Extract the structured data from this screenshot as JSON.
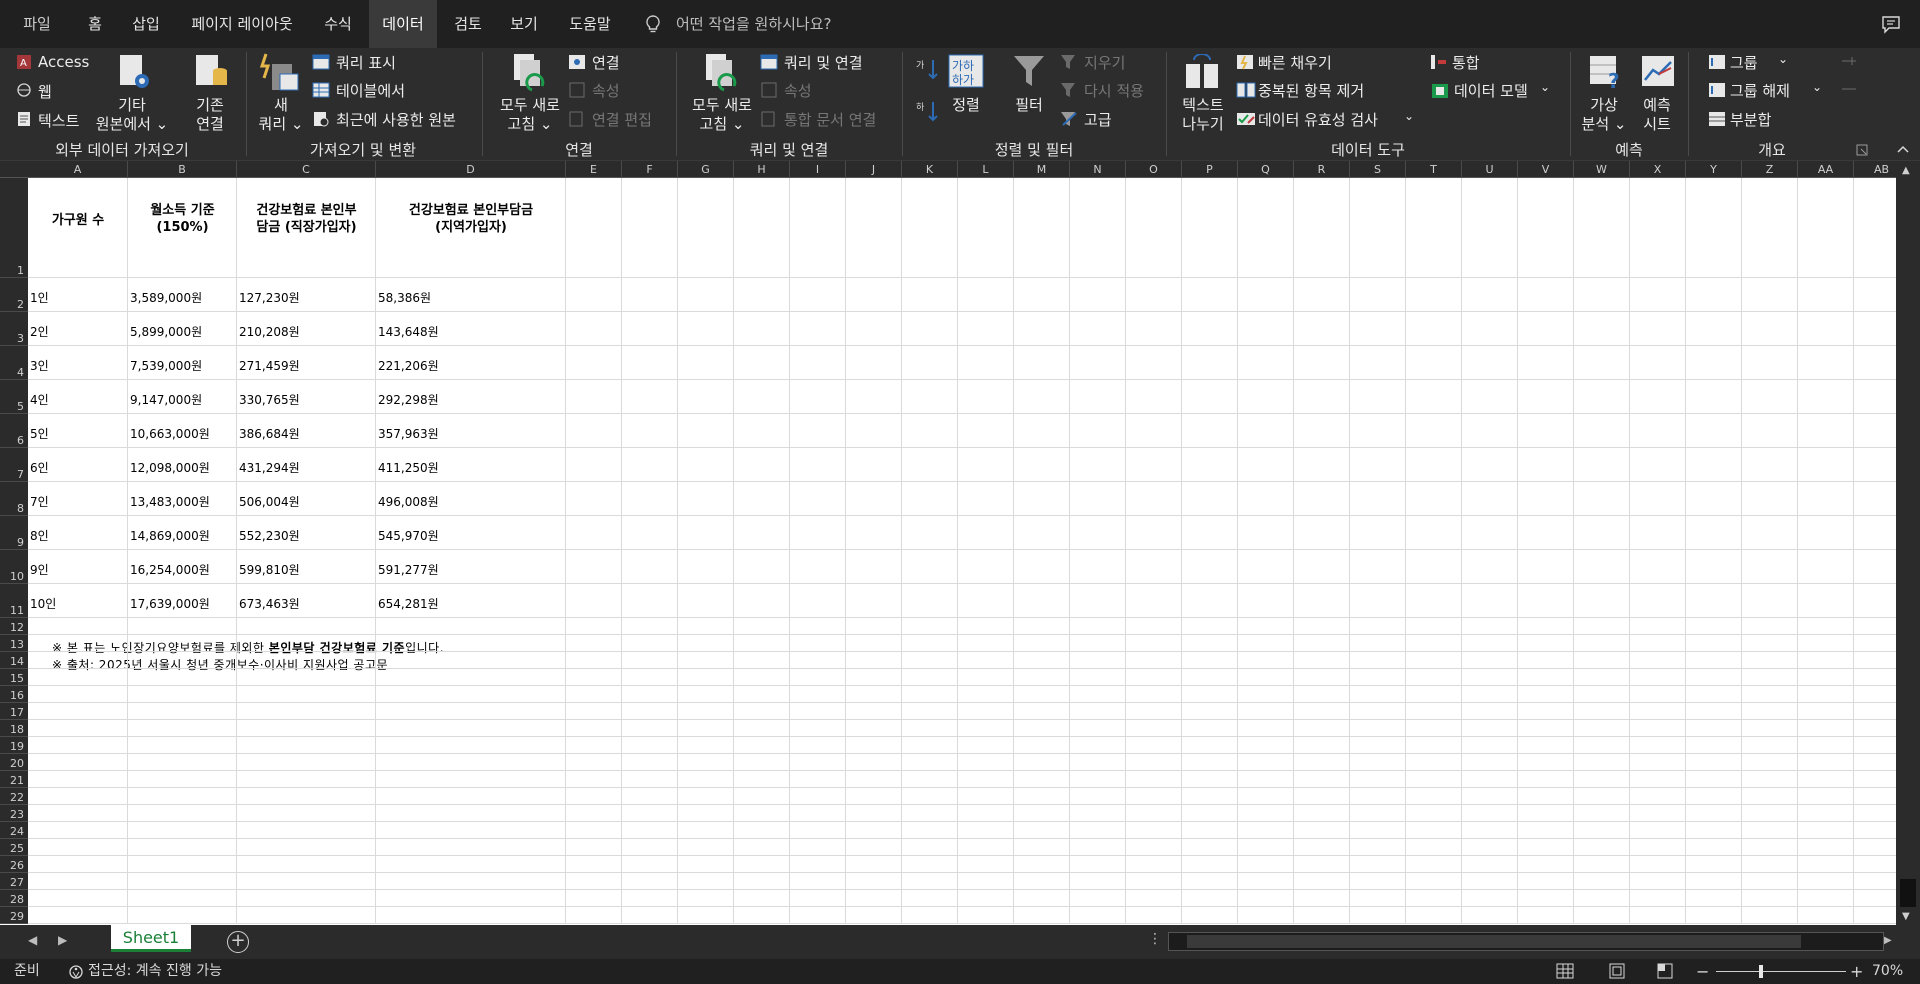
{
  "tabs": [
    "파일",
    "홈",
    "삽입",
    "페이지 레이아웃",
    "수식",
    "데이터",
    "검토",
    "보기",
    "도움말"
  ],
  "active_tab": "데이터",
  "tell_me": "어떤 작업을 원하시나요?",
  "ribbon": {
    "external": {
      "access": "Access",
      "web": "웹",
      "text": "텍스트",
      "other_l1": "기타",
      "other_l2": "원본에서 ⌄",
      "existing_l1": "기존",
      "existing_l2": "연결",
      "label": "외부 데이터 가져오기"
    },
    "transform": {
      "new_query_l1": "새",
      "new_query_l2": "쿼리 ⌄",
      "show_queries": "쿼리 표시",
      "from_table": "테이블에서",
      "recent": "최근에 사용한 원본",
      "label": "가져오기 및 변환"
    },
    "connections": {
      "refresh_l1": "모두 새로",
      "refresh_l2": "고침 ⌄",
      "connections": "연결",
      "properties": "속성",
      "edit_links": "연결 편집",
      "label": "연결"
    },
    "queries": {
      "refresh_l1": "모두 새로",
      "refresh_l2": "고침 ⌄",
      "queries_connections": "쿼리 및 연결",
      "properties": "속성",
      "workbook_links": "통합 문서 연결",
      "label": "쿼리 및 연결"
    },
    "sort": {
      "sort": "정렬",
      "filter": "필터",
      "clear": "지우기",
      "reapply": "다시 적용",
      "advanced": "고급",
      "label": "정렬 및 필터"
    },
    "tools": {
      "ttc_l1": "텍스트",
      "ttc_l2": "나누기",
      "flash_fill": "빠른 채우기",
      "remove_dup": "중복된 항목 제거",
      "validation": "데이터 유효성 검사",
      "consolidate": "통합",
      "data_model": "데이터 모델",
      "label": "데이터 도구"
    },
    "forecast": {
      "whatif_l1": "가상",
      "whatif_l2": "분석 ⌄",
      "sheet_l1": "예측",
      "sheet_l2": "시트",
      "label": "예측"
    },
    "outline": {
      "group": "그룹",
      "ungroup": "그룹 해제",
      "subtotal": "부분합",
      "label": "개요"
    }
  },
  "columns": [
    "A",
    "B",
    "C",
    "D",
    "E",
    "F",
    "G",
    "H",
    "I",
    "J",
    "K",
    "L",
    "M",
    "N",
    "O",
    "P",
    "Q",
    "R",
    "S",
    "T",
    "U",
    "V",
    "W",
    "X",
    "Y",
    "Z",
    "AA",
    "AB"
  ],
  "rows": [
    "1",
    "2",
    "3",
    "4",
    "5",
    "6",
    "7",
    "8",
    "9",
    "10",
    "11",
    "12",
    "13",
    "14",
    "15",
    "16",
    "17",
    "18",
    "19",
    "20",
    "21",
    "22",
    "23",
    "24",
    "25",
    "26",
    "27",
    "28",
    "29"
  ],
  "table": {
    "headers": {
      "a": "가구원 수",
      "b_l1": "월소득 기준",
      "b_l2": "(150%)",
      "c_l1": "건강보험료 본인부",
      "c_l2": "담금 (직장가입자)",
      "d_l1": "건강보험료 본인부담금",
      "d_l2": "(지역가입자)"
    },
    "rows": [
      [
        "1인",
        "3,589,000원",
        "127,230원",
        "58,386원"
      ],
      [
        "2인",
        "5,899,000원",
        "210,208원",
        "143,648원"
      ],
      [
        "3인",
        "7,539,000원",
        "271,459원",
        "221,206원"
      ],
      [
        "4인",
        "9,147,000원",
        "330,765원",
        "292,298원"
      ],
      [
        "5인",
        "10,663,000원",
        "386,684원",
        "357,963원"
      ],
      [
        "6인",
        "12,098,000원",
        "431,294원",
        "411,250원"
      ],
      [
        "7인",
        "13,483,000원",
        "506,004원",
        "496,008원"
      ],
      [
        "8인",
        "14,869,000원",
        "552,230원",
        "545,970원"
      ],
      [
        "9인",
        "16,254,000원",
        "599,810원",
        "591,277원"
      ],
      [
        "10인",
        "17,639,000원",
        "673,463원",
        "654,281원"
      ]
    ],
    "note1_a": "※ 본 표는 노인장기요양보험료를 제외한 ",
    "note1_b": "본인부담 건강보험료 기준",
    "note1_c": "입니다.",
    "note2": "※ 출처: 2025년 서울시 청년 중개보수·이사비 지원사업 공고문"
  },
  "sheet_tab": "Sheet1",
  "status": {
    "ready": "준비",
    "accessibility": "접근성: 계속 진행 가능",
    "zoom": "70%"
  }
}
